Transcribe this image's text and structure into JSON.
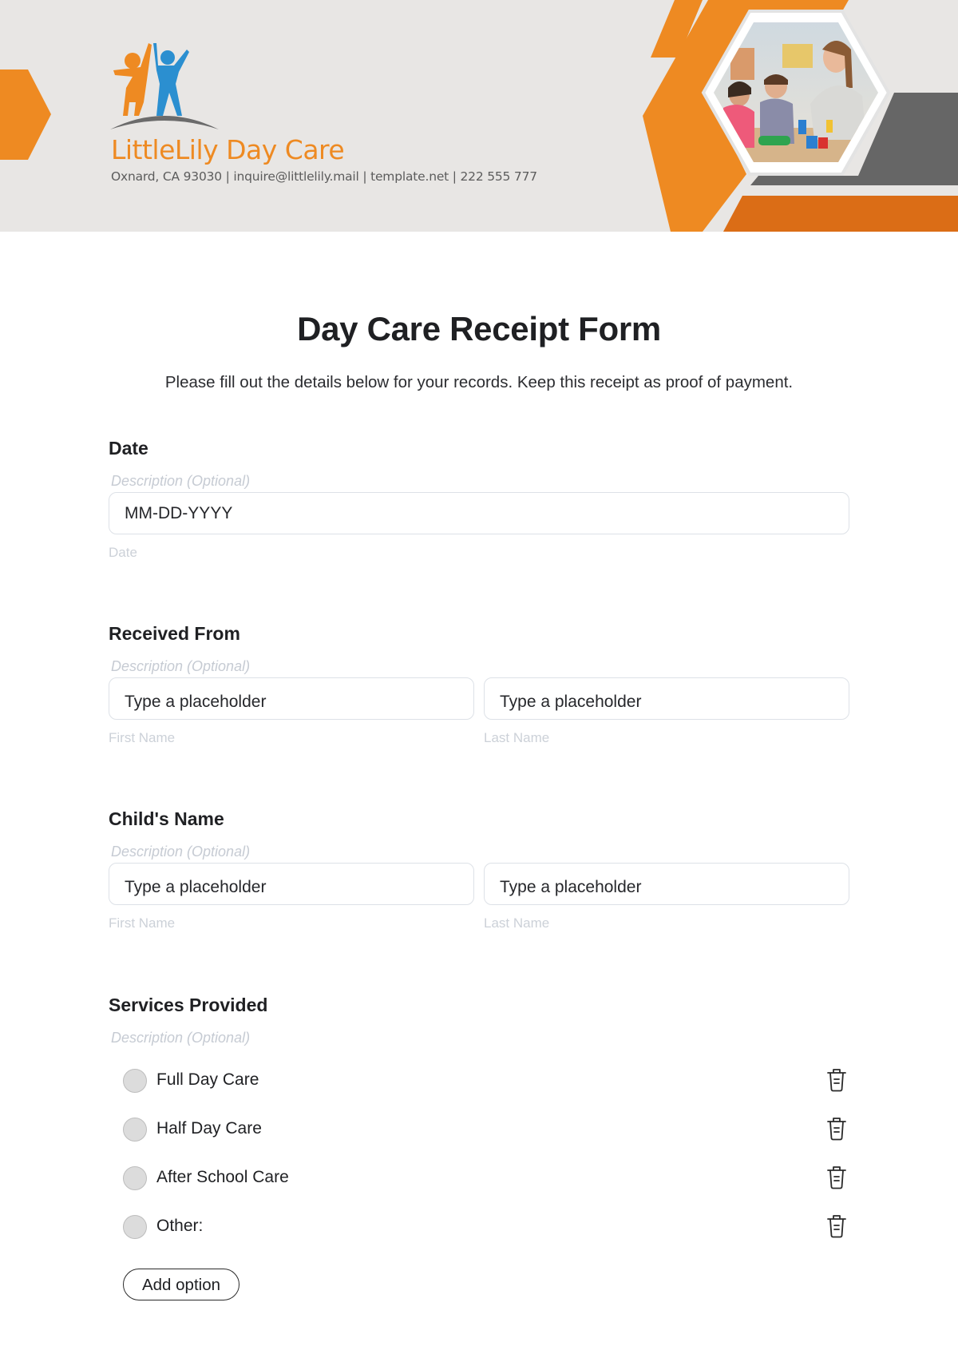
{
  "header": {
    "brand_name": "LittleLily Day Care",
    "contact_line": "Oxnard, CA 93030 | inquire@littlelily.mail | template.net | 222 555 777",
    "logo_icon": "two-children-jumping-logo",
    "photo_alt": "teacher-with-children-playing-blocks-photo",
    "colors": {
      "orange": "#ee8a22",
      "dark_orange": "#db6d16",
      "gray": "#666666",
      "blue": "#2b8fd0",
      "background": "#e8e6e4"
    }
  },
  "form": {
    "title": "Day Care Receipt Form",
    "subtitle": "Please fill out the details below for your records. Keep this receipt as proof of payment.",
    "questions": [
      {
        "label": "Date",
        "description": "Description (Optional)",
        "fields": [
          {
            "placeholder": "MM-DD-YYYY",
            "sublabel": "Date"
          }
        ]
      },
      {
        "label": "Received From",
        "description": "Description (Optional)",
        "fields": [
          {
            "placeholder": "Type a placeholder",
            "sublabel": "First Name"
          },
          {
            "placeholder": "Type a placeholder",
            "sublabel": "Last Name"
          }
        ]
      },
      {
        "label": "Child's Name",
        "description": "Description (Optional)",
        "fields": [
          {
            "placeholder": "Type a placeholder",
            "sublabel": "First Name"
          },
          {
            "placeholder": "Type a placeholder",
            "sublabel": "Last Name"
          }
        ]
      },
      {
        "label": "Services Provided",
        "description": "Description (Optional)",
        "options": [
          {
            "label": "Full Day Care",
            "selected": false
          },
          {
            "label": "Half Day Care",
            "selected": false
          },
          {
            "label": "After School Care",
            "selected": false
          },
          {
            "label": "Other:",
            "selected": false
          }
        ],
        "add_option_label": "Add option"
      }
    ]
  }
}
